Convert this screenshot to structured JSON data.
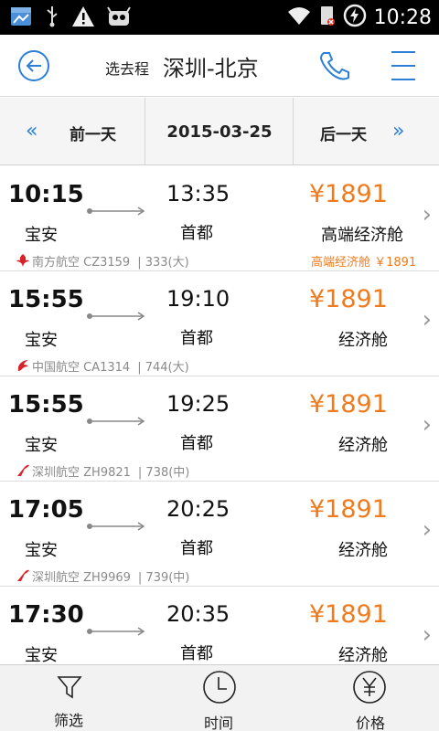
{
  "status_bar": {
    "time": "10:28",
    "icons": [
      "app-notification-icon",
      "usb-icon",
      "warning-icon",
      "android-icon",
      "wifi-icon",
      "no-sim-icon",
      "battery-charging-icon"
    ]
  },
  "header": {
    "prefix": "选去程",
    "route": "深圳-北京",
    "icons": [
      "back-arrow-icon",
      "phone-icon",
      "menu-icon"
    ]
  },
  "date_bar": {
    "prev_label": "前一天",
    "date": "2015-03-25",
    "next_label": "后一天"
  },
  "flights": [
    {
      "dep_time": "10:15",
      "arr_time": "13:35",
      "dep_airport": "宝安",
      "arr_airport": "首都",
      "price": "¥1891",
      "cabin": "高端经济舱",
      "airline": "南方航空 CZ3159",
      "aircraft": "| 333(大)",
      "cabin_note": "高端经济舱 ￥1891",
      "airline_color": "#d8222a"
    },
    {
      "dep_time": "15:55",
      "arr_time": "19:10",
      "dep_airport": "宝安",
      "arr_airport": "首都",
      "price": "¥1891",
      "cabin": "经济舱",
      "airline": "中国航空 CA1314",
      "aircraft": "| 744(大)",
      "airline_color": "#d8222a"
    },
    {
      "dep_time": "15:55",
      "arr_time": "19:25",
      "dep_airport": "宝安",
      "arr_airport": "首都",
      "price": "¥1891",
      "cabin": "经济舱",
      "airline": "深圳航空 ZH9821",
      "aircraft": "| 738(中)",
      "airline_color": "#d8222a"
    },
    {
      "dep_time": "17:05",
      "arr_time": "20:25",
      "dep_airport": "宝安",
      "arr_airport": "首都",
      "price": "¥1891",
      "cabin": "经济舱",
      "airline": "深圳航空 ZH9969",
      "aircraft": "| 739(中)",
      "airline_color": "#d8222a"
    },
    {
      "dep_time": "17:30",
      "arr_time": "20:35",
      "dep_airport": "宝安",
      "arr_airport": "首都",
      "price": "¥1891",
      "cabin": "经济舱"
    }
  ],
  "bottom_bar": {
    "tabs": [
      {
        "label": "筛选",
        "icon": "filter-icon"
      },
      {
        "label": "时间",
        "icon": "clock-icon"
      },
      {
        "label": "价格",
        "icon": "yen-icon"
      }
    ]
  },
  "colors": {
    "accent_blue": "#2b7fd6",
    "price_orange": "#f07b1e"
  }
}
